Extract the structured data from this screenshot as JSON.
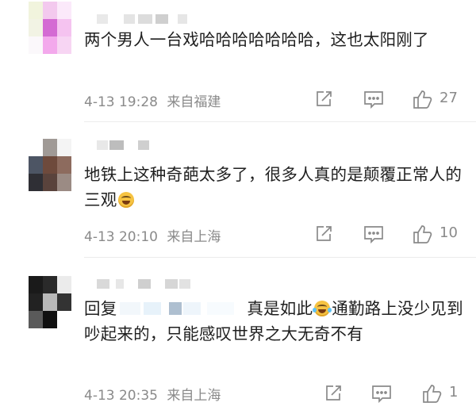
{
  "comments": [
    {
      "text": "两个男人一台戏哈哈哈哈哈哈哈，这也太阳刚了",
      "date": "4-13 19:28",
      "location": "来自福建",
      "likes": "27",
      "share_icon": "share-icon",
      "comment_icon": "comment-icon",
      "like_icon": "thumbs-up-icon"
    },
    {
      "text": "地铁上这种奇葩太多了，很多人真的是颠覆正常人的三观",
      "emoji": "laughing-emoji",
      "date": "4-13 20:10",
      "location": "来自上海",
      "likes": "10"
    },
    {
      "reply_prefix": "回复",
      "text_a": "真是如此",
      "emoji": "laughing-crying-emoji",
      "text_b": "通勤路上没少见到吵起来的，只能感叹世界之大无奇不有",
      "date": "4-13 20:35",
      "location": "来自上海",
      "likes": "1"
    }
  ],
  "colors": {
    "text": "#1f1f1f",
    "meta": "#8a8a8a",
    "divider": "#ececec"
  }
}
